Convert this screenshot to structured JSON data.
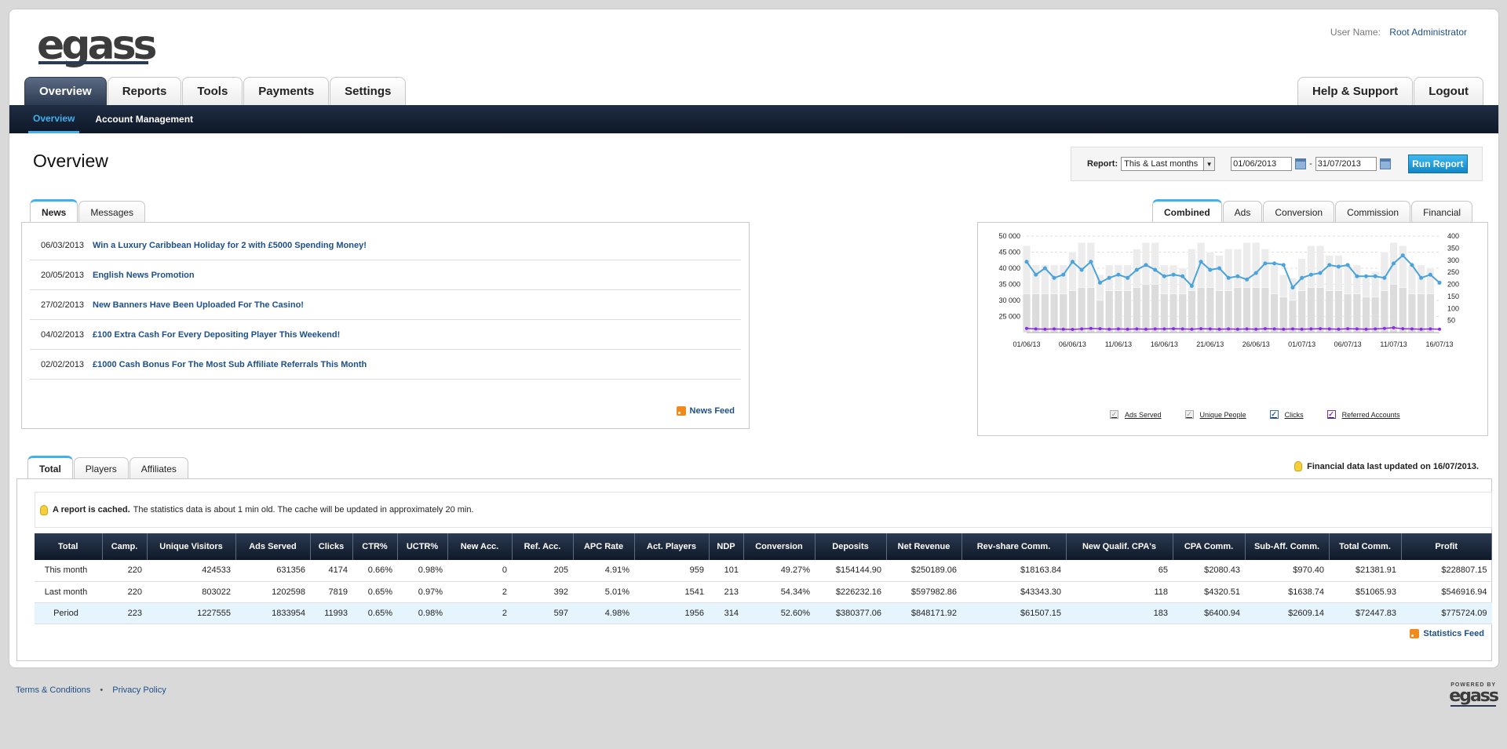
{
  "logo": "egass",
  "user": {
    "label": "User Name:",
    "name": "Root Administrator"
  },
  "main_tabs": [
    "Overview",
    "Reports",
    "Tools",
    "Payments",
    "Settings"
  ],
  "right_tabs": [
    "Help & Support",
    "Logout"
  ],
  "subnav": [
    "Overview",
    "Account Management"
  ],
  "page_title": "Overview",
  "report": {
    "label": "Report:",
    "period": "This & Last months",
    "from": "01/06/2013",
    "to": "31/07/2013",
    "run": "Run Report"
  },
  "news_tabs": [
    "News",
    "Messages"
  ],
  "news": [
    {
      "date": "06/03/2013",
      "title": "Win a Luxury Caribbean Holiday for 2 with £5000 Spending Money!"
    },
    {
      "date": "20/05/2013",
      "title": "English News Promotion"
    },
    {
      "date": "27/02/2013",
      "title": "New Banners Have Been Uploaded For The Casino!"
    },
    {
      "date": "04/02/2013",
      "title": "£100 Extra Cash For Every Depositing Player This Weekend!"
    },
    {
      "date": "02/02/2013",
      "title": "£1000 Cash Bonus For The Most Sub Affiliate Referrals This Month"
    }
  ],
  "news_feed": "News Feed",
  "chart_tabs": [
    "Combined",
    "Ads",
    "Conversion",
    "Commission",
    "Financial"
  ],
  "chart_legend": [
    {
      "label": "Ads Served",
      "checked": false
    },
    {
      "label": "Unique People",
      "checked": false
    },
    {
      "label": "Clicks",
      "checked": true
    },
    {
      "label": "Referred Accounts",
      "checked": true
    }
  ],
  "chart_data": {
    "type": "line",
    "x_ticks": [
      "01/06/13",
      "06/06/13",
      "11/06/13",
      "16/06/13",
      "21/06/13",
      "26/06/13",
      "01/07/13",
      "06/07/13",
      "11/07/13",
      "16/07/13"
    ],
    "y_left_ticks": [
      "50 000",
      "45 000",
      "40 000",
      "35 000",
      "30 000",
      "25 000"
    ],
    "y_right_ticks": [
      "400",
      "350",
      "300",
      "250",
      "200",
      "150",
      "100",
      "50"
    ],
    "ylim_left": [
      20000,
      50000
    ],
    "ylim_right": [
      0,
      400
    ],
    "series": [
      {
        "name": "Ads Served",
        "axis": "left",
        "values": [
          47000,
          41000,
          41000,
          41000,
          41000,
          45000,
          48000,
          48000,
          38000,
          41000,
          41000,
          41000,
          46000,
          48000,
          48000,
          41000,
          41000,
          40000,
          46000,
          48000,
          45000,
          44000,
          46000,
          46000,
          48000,
          48000,
          46000,
          41000,
          38000,
          37000,
          43000,
          47000,
          47000,
          44000,
          44000,
          41000,
          41000,
          37000,
          39000,
          45000,
          48000,
          47000,
          41000,
          41000,
          40000
        ]
      },
      {
        "name": "Unique People",
        "axis": "left",
        "values": [
          32000,
          32000,
          32000,
          32000,
          32000,
          33000,
          34000,
          34000,
          30000,
          33000,
          33000,
          33000,
          34000,
          35000,
          35000,
          32000,
          32000,
          32000,
          33000,
          34000,
          34000,
          33000,
          33000,
          34000,
          34000,
          34000,
          34000,
          32000,
          31000,
          30000,
          33000,
          34000,
          34000,
          33000,
          33000,
          32000,
          32000,
          31000,
          31000,
          33000,
          35000,
          34000,
          32000,
          32000,
          32000
        ]
      },
      {
        "name": "Clicks",
        "axis": "left",
        "values": [
          42000,
          38000,
          40000,
          37000,
          38000,
          42000,
          39500,
          42000,
          35500,
          37000,
          38000,
          37000,
          39500,
          41000,
          39500,
          37500,
          38000,
          37500,
          34500,
          42000,
          39500,
          40000,
          37000,
          37500,
          36500,
          38500,
          41500,
          41500,
          41000,
          34000,
          37000,
          38000,
          38500,
          41000,
          40500,
          41000,
          37500,
          37500,
          37500,
          37000,
          41500,
          44000,
          41000,
          37000,
          38000,
          35500
        ]
      },
      {
        "name": "Referred Accounts",
        "axis": "right",
        "values": [
          17,
          15,
          14,
          15,
          14,
          13,
          15,
          17,
          16,
          14,
          15,
          14,
          15,
          14,
          15,
          15,
          16,
          15,
          14,
          16,
          15,
          14,
          15,
          14,
          15,
          14,
          16,
          15,
          14,
          15,
          14,
          15,
          16,
          15,
          14,
          16,
          15,
          14,
          15,
          17,
          20,
          16,
          15,
          14,
          15,
          14
        ]
      }
    ]
  },
  "stats_tabs": [
    "Total",
    "Players",
    "Affiliates"
  ],
  "financial_updated": "Financial data last updated on 16/07/2013.",
  "cache_notice": {
    "bold": "A report is cached.",
    "text": "The statistics data is about 1 min old. The cache will be updated in approximately 20 min."
  },
  "table": {
    "headers": [
      "Total",
      "Camp.",
      "Unique Visitors",
      "Ads Served",
      "Clicks",
      "CTR%",
      "UCTR%",
      "New Acc.",
      "Ref. Acc.",
      "APC Rate",
      "Act. Players",
      "NDP",
      "Conversion",
      "Deposits",
      "Net Revenue",
      "Rev-share Comm.",
      "New Qualif. CPA's",
      "CPA Comm.",
      "Sub-Aff. Comm.",
      "Total Comm.",
      "Profit"
    ],
    "rows": [
      [
        "This month",
        "220",
        "424533",
        "631356",
        "4174",
        "0.66%",
        "0.98%",
        "0",
        "205",
        "4.91%",
        "959",
        "101",
        "49.27%",
        "$154144.90",
        "$250189.06",
        "$18163.84",
        "65",
        "$2080.43",
        "$970.40",
        "$21381.91",
        "$228807.15"
      ],
      [
        "Last month",
        "220",
        "803022",
        "1202598",
        "7819",
        "0.65%",
        "0.97%",
        "2",
        "392",
        "5.01%",
        "1541",
        "213",
        "54.34%",
        "$226232.16",
        "$597982.86",
        "$43343.30",
        "118",
        "$4320.51",
        "$1638.74",
        "$51065.93",
        "$546916.94"
      ],
      [
        "Period",
        "223",
        "1227555",
        "1833954",
        "11993",
        "0.65%",
        "0.98%",
        "2",
        "597",
        "4.98%",
        "1956",
        "314",
        "52.60%",
        "$380377.06",
        "$848171.92",
        "$61507.15",
        "183",
        "$6400.94",
        "$2609.14",
        "$72447.83",
        "$775724.09"
      ]
    ]
  },
  "stats_feed": "Statistics Feed",
  "footer": {
    "terms": "Terms & Conditions",
    "sep": "•",
    "privacy": "Privacy Policy",
    "powered": "POWERED BY",
    "powered_logo": "egass"
  },
  "colors": {
    "nav_dark": "#1f2d43",
    "accent": "#3fb0f0",
    "link": "#1d4f89",
    "clicks_line": "#4aa3da",
    "referred_line": "#8a2be2"
  }
}
